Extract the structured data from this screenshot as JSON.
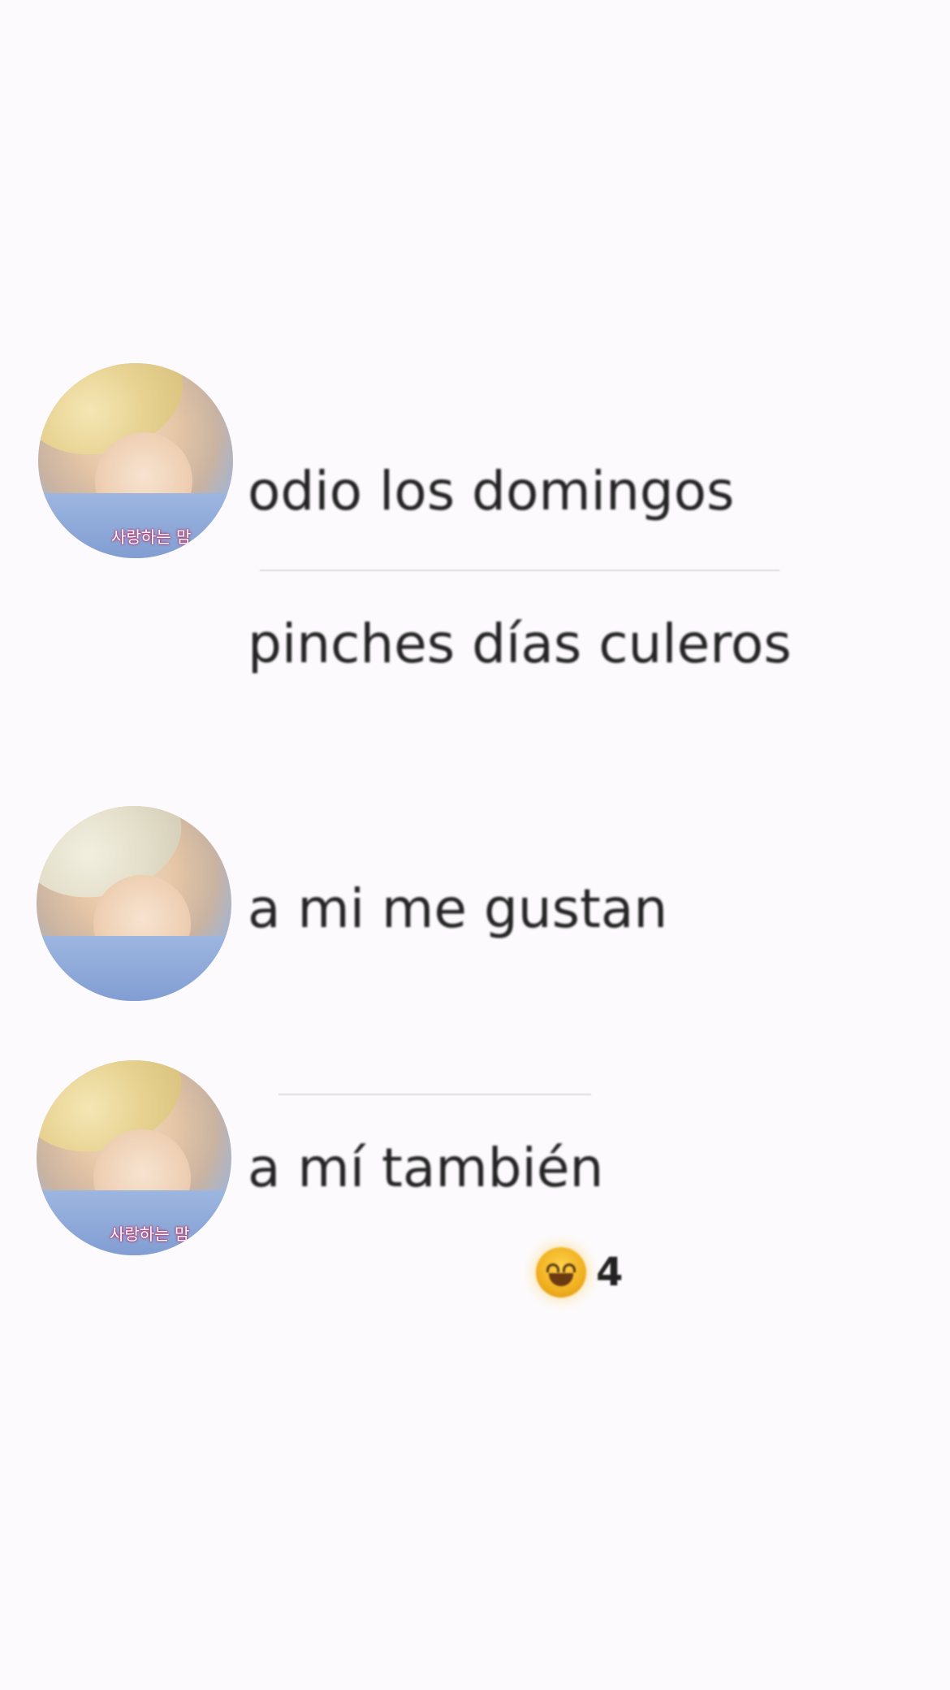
{
  "messages": [
    {
      "text": "odio los domingos"
    },
    {
      "text": "pinches días culeros"
    },
    {
      "text": "a mi me gustan"
    },
    {
      "text": "a mí también"
    }
  ],
  "avatars": [
    {
      "caption": "사랑하는 맘"
    },
    {
      "caption": ""
    },
    {
      "caption": "사랑하는 맘"
    }
  ],
  "reaction": {
    "emoji": "grinning-face",
    "count": "4"
  }
}
